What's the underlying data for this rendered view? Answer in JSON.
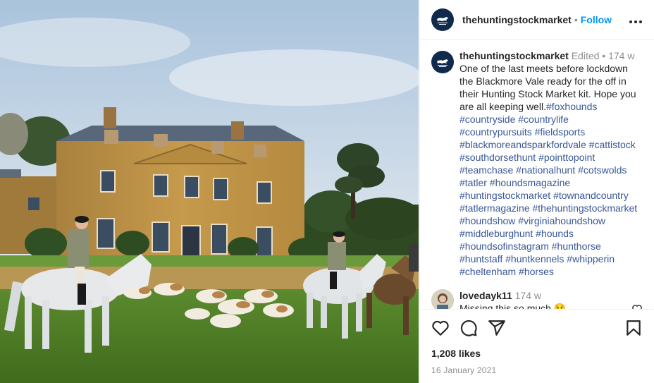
{
  "post": {
    "account": "thehuntingstockmarket",
    "separator": "•",
    "follow_label": "Follow",
    "more_label": "•••",
    "logo_text": "THE HUNTING STOCK MARKET",
    "caption": {
      "username": "thehuntingstockmarket",
      "edited": "Edited",
      "bullet": "•",
      "age": "174 w",
      "text": "One of the last meets before lockdown the Blackmore Vale ready for the off in their Hunting Stock Market kit. Hope you are all keeping well.",
      "hashtags": "#foxhounds #countryside #countrylife #countrypursuits #fieldsports #blackmoreandsparkfordvale #cattistock #southdorsethunt #pointtopoint #teamchase #nationalhunt #cotswolds #tatler #houndsmagazine #huntingstockmarket #townandcountry #tatlermagazine #thehuntingstockmarket #houndshow #virginiahoundshow #middleburghunt #hounds #houndsofinstagram #hunthorse #huntstaff #huntkennels #whipperin #cheltenham #horses"
    },
    "comments": [
      {
        "username": "lovedayk11",
        "age": "174 w",
        "text": "Missing this so much 😢"
      }
    ],
    "likes": "1,208 likes",
    "date": "16 January 2021"
  },
  "colors": {
    "link": "#385898",
    "follow": "#0095f6",
    "muted": "#8e8e8e",
    "avatar_bg": "#0f2a4d"
  },
  "icons": [
    "logo-avatar",
    "more-icon",
    "like-icon",
    "comment-icon",
    "share-icon",
    "save-icon",
    "comment-like-icon"
  ]
}
